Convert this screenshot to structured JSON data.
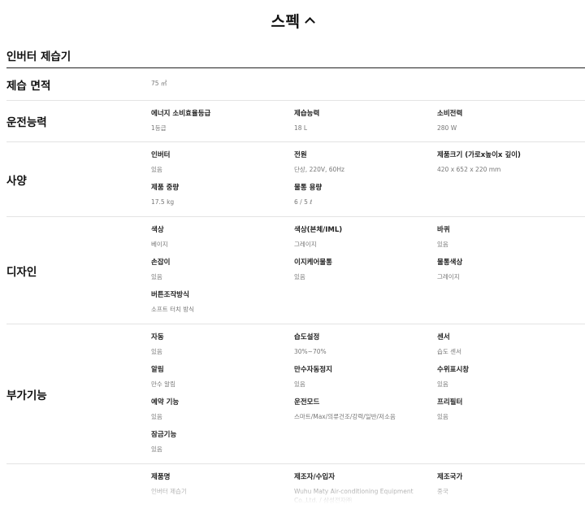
{
  "header": {
    "title": "스펙"
  },
  "product_name": "인버터 제습기",
  "sections": {
    "area": {
      "title": "제습 면적",
      "items": [
        {
          "label": "",
          "value": "75 ㎡"
        }
      ]
    },
    "capacity": {
      "title": "운전능력",
      "items": [
        {
          "label": "에너지 소비효율등급",
          "value": "1등급"
        },
        {
          "label": "제습능력",
          "value": "18 L"
        },
        {
          "label": "소비전력",
          "value": "280 W"
        }
      ]
    },
    "spec": {
      "title": "사양",
      "items": [
        {
          "label": "인버터",
          "value": "있음"
        },
        {
          "label": "전원",
          "value": "단상, 220V, 60Hz"
        },
        {
          "label": "제품크기 (가로x높이x 깊이)",
          "value": "420 x 652 x 220 mm"
        },
        {
          "label": "제품 중량",
          "value": "17.5 kg"
        },
        {
          "label": "물통 용량",
          "value": "6 / 5 ℓ"
        }
      ]
    },
    "design": {
      "title": "디자인",
      "items": [
        {
          "label": "색상",
          "value": "베이지"
        },
        {
          "label": "색상(본체/IML)",
          "value": "그레이지"
        },
        {
          "label": "바퀴",
          "value": "있음"
        },
        {
          "label": "손잡이",
          "value": "있음"
        },
        {
          "label": "이지케어물통",
          "value": "있음"
        },
        {
          "label": "물통색상",
          "value": "그레이지"
        },
        {
          "label": "버튼조작방식",
          "value": "소프트 터치 방식"
        }
      ]
    },
    "extra": {
      "title": "부가기능",
      "items": [
        {
          "label": "자동",
          "value": "있음"
        },
        {
          "label": "습도설정",
          "value": "30%~70%"
        },
        {
          "label": "센서",
          "value": "습도 센서"
        },
        {
          "label": "알림",
          "value": "만수 알림"
        },
        {
          "label": "만수자동정지",
          "value": "있음"
        },
        {
          "label": "수위표시창",
          "value": "있음"
        },
        {
          "label": "예약 기능",
          "value": "있음"
        },
        {
          "label": "운전모드",
          "value": "스마트/Max/의류건조/강력/일반/저소음"
        },
        {
          "label": "프리필터",
          "value": "있음"
        },
        {
          "label": "잠금기능",
          "value": "있음"
        }
      ]
    },
    "maker": {
      "title": "",
      "items": [
        {
          "label": "제품명",
          "value": "인버터 제습기"
        },
        {
          "label": "제조자/수입자",
          "value": "Wuhu Maty Air-conditioning Equipment Co.,Ltd. / 삼성전자㈜"
        },
        {
          "label": "제조국가",
          "value": "중국"
        }
      ]
    }
  }
}
